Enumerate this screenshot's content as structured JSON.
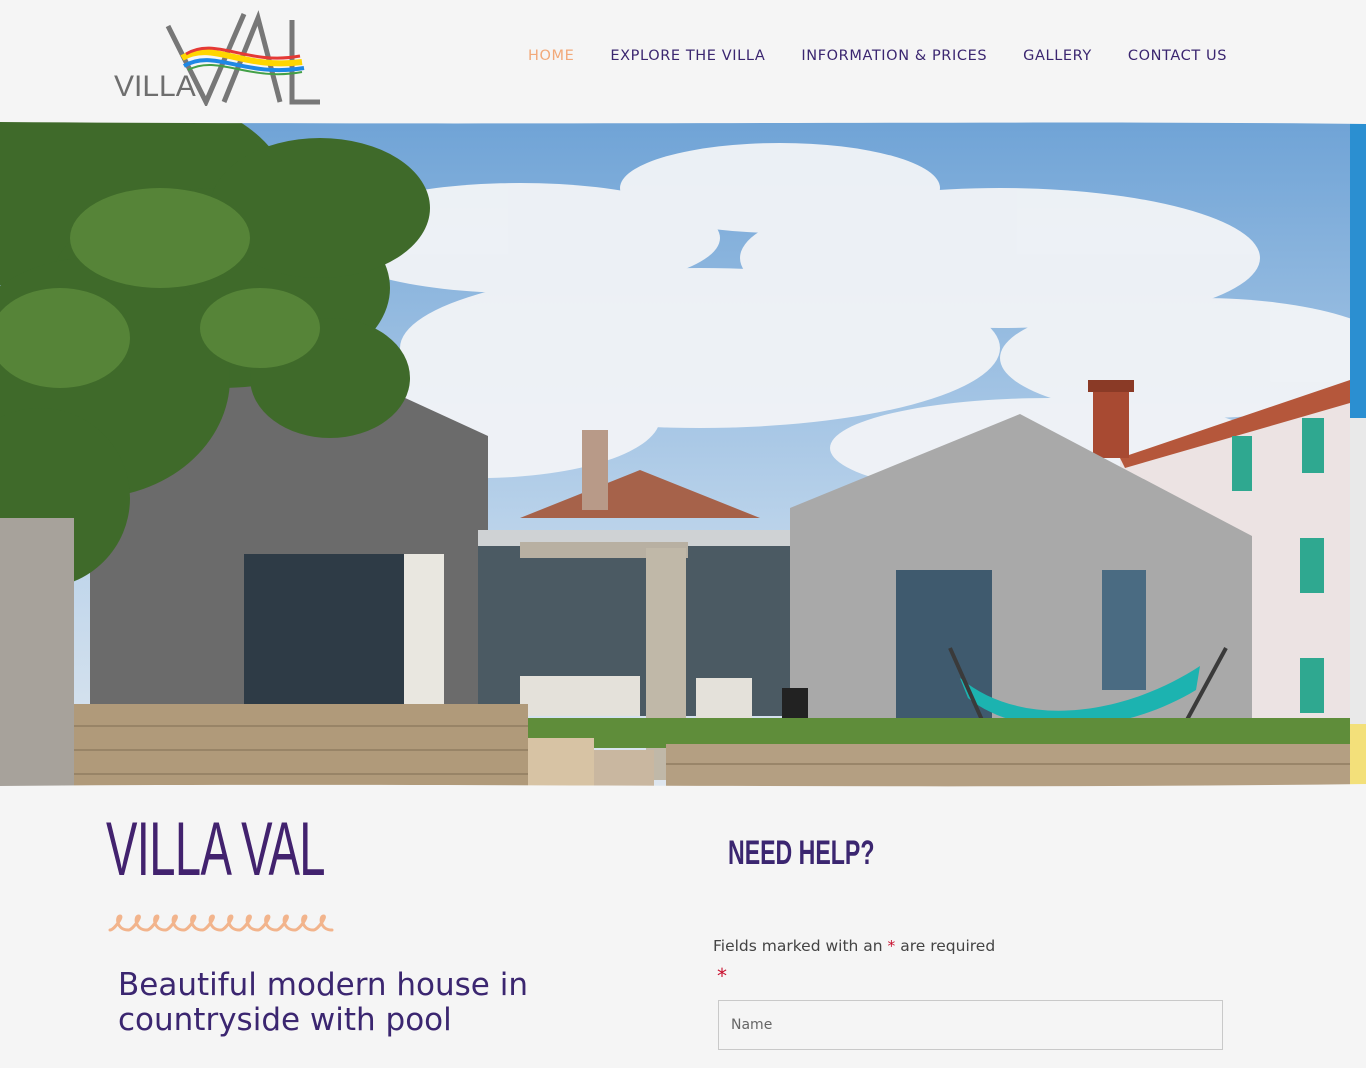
{
  "header": {
    "logo_small": "VILLA",
    "logo_big": "VAL",
    "logo_colors": [
      "#e53935",
      "#ffd600",
      "#1e88e5",
      "#43a047"
    ],
    "nav": [
      {
        "label": "HOME",
        "active": true
      },
      {
        "label": "EXPLORE THE VILLA",
        "active": false
      },
      {
        "label": "INFORMATION & PRICES",
        "active": false
      },
      {
        "label": "GALLERY",
        "active": false
      },
      {
        "label": "CONTACT US",
        "active": false
      }
    ]
  },
  "hero": {
    "image": "villa-exterior-photo"
  },
  "intro": {
    "title": "VILLA VAL",
    "tagline": "Beautiful modern house in countryside with pool"
  },
  "contact": {
    "title": "NEED HELP?",
    "required_prefix": "Fields marked with an",
    "required_star": "*",
    "required_suffix": "are required",
    "field_star": "*",
    "name_placeholder": "Name"
  },
  "colors": {
    "brand_purple": "#3b2670",
    "accent_orange": "#f2a979",
    "required_red": "#c8102e"
  }
}
